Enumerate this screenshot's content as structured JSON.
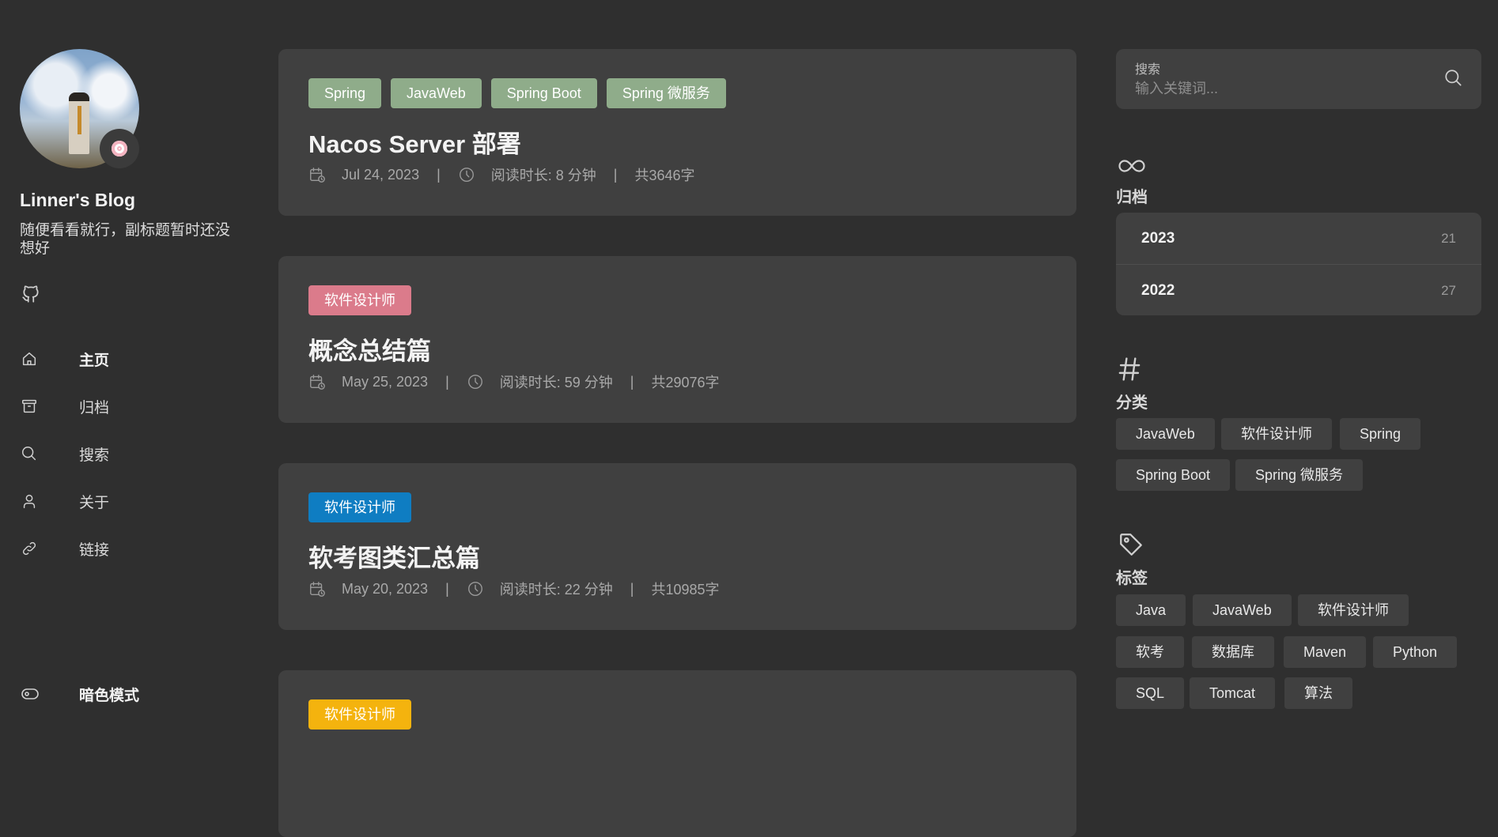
{
  "profile": {
    "blog_title": "Linner's Blog",
    "subtitle": "随便看看就行，副标题暂时还没想好"
  },
  "nav": {
    "items": [
      {
        "label": "主页",
        "icon": "home-icon",
        "active": true
      },
      {
        "label": "归档",
        "icon": "archive-box-icon",
        "active": false
      },
      {
        "label": "搜索",
        "icon": "search-icon",
        "active": false
      },
      {
        "label": "关于",
        "icon": "user-icon",
        "active": false
      },
      {
        "label": "链接",
        "icon": "link-icon",
        "active": false
      }
    ],
    "dark_mode_label": "暗色模式"
  },
  "posts": [
    {
      "tags": [
        {
          "label": "Spring",
          "color": "#8fac8a"
        },
        {
          "label": "JavaWeb",
          "color": "#8fac8a"
        },
        {
          "label": "Spring Boot",
          "color": "#8fac8a"
        },
        {
          "label": "Spring 微服务",
          "color": "#8fac8a"
        }
      ],
      "title": "Nacos Server 部署",
      "date": "Jul 24, 2023",
      "read_time": "阅读时长: 8 分钟",
      "word_count": "共3646字"
    },
    {
      "tags": [
        {
          "label": "软件设计师",
          "color": "#db7b8b"
        }
      ],
      "title": "概念总结篇",
      "date": "May 25, 2023",
      "read_time": "阅读时长: 59 分钟",
      "word_count": "共29076字"
    },
    {
      "tags": [
        {
          "label": "软件设计师",
          "color": "#0f7dc2"
        }
      ],
      "title": "软考图类汇总篇",
      "date": "May 20, 2023",
      "read_time": "阅读时长: 22 分钟",
      "word_count": "共10985字"
    },
    {
      "tags": [
        {
          "label": "软件设计师",
          "color": "#f4b30e"
        }
      ],
      "title": "",
      "date": "",
      "read_time": "",
      "word_count": ""
    }
  ],
  "search": {
    "label": "搜索",
    "placeholder": "输入关键词..."
  },
  "archives": {
    "title": "归档",
    "icon": "infinity-icon",
    "years": [
      {
        "year": "2023",
        "count": "21"
      },
      {
        "year": "2022",
        "count": "27"
      }
    ]
  },
  "categories": {
    "title": "分类",
    "icon": "hash-icon",
    "items": [
      "JavaWeb",
      "软件设计师",
      "Spring",
      "Spring Boot",
      "Spring 微服务"
    ]
  },
  "tags_section": {
    "title": "标签",
    "icon": "tag-icon",
    "items": [
      "Java",
      "JavaWeb",
      "软件设计师",
      "软考",
      "数据库",
      "Maven",
      "Python",
      "SQL",
      "Tomcat",
      "算法"
    ]
  }
}
